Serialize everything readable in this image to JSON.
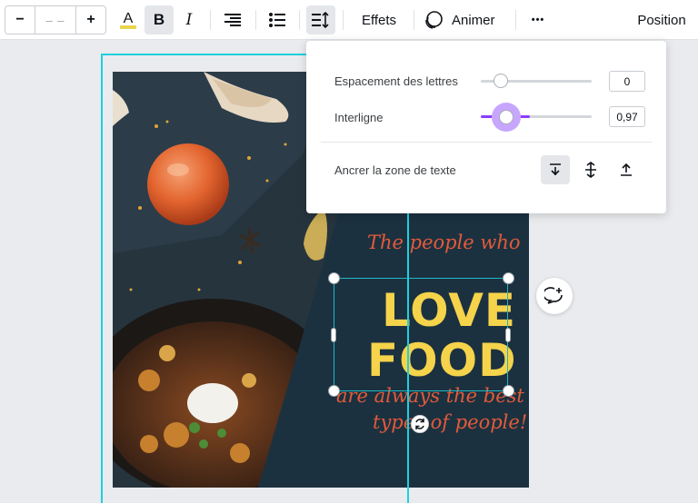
{
  "toolbar": {
    "font_size_value": "– –",
    "decrease_label": "−",
    "increase_label": "+",
    "effects_label": "Effets",
    "animate_label": "Animer",
    "more_label": "•••",
    "position_label": "Position"
  },
  "spacing_popover": {
    "letter_spacing_label": "Espacement des lettres",
    "letter_spacing_value": "0",
    "line_height_label": "Interligne",
    "line_height_value": "0,97",
    "anchor_label": "Ancrer la zone de texte"
  },
  "design": {
    "line1": "The people who",
    "line2": "LOVE",
    "line3": "FOOD",
    "line4": "are always the best",
    "line5": "types of people!"
  },
  "colors": {
    "accent": "#8b3dff",
    "selection": "#1fb8c6",
    "design_bg": "#1b3140",
    "script_text": "#e45a3a",
    "headline_text": "#f5d34a"
  }
}
